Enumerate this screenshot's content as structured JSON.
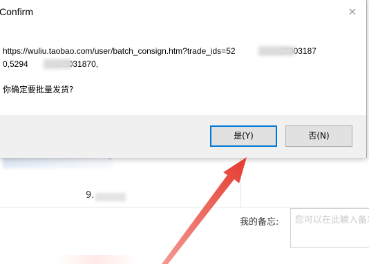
{
  "dialog": {
    "title": "Confirm",
    "close_glyph": "×",
    "message_line1": "https://wuliu.taobao.com/user/batch_consign.htm?trade_ids=52",
    "message_line1_tail": "17003187",
    "message_line2_head": "0,5294",
    "message_line2_tail": "240031870,",
    "question": "你确定要批量发货?",
    "yes_label": "是(Y)",
    "no_label": "否(N)",
    "accent_color": "#0078d7"
  },
  "background": {
    "number_prefix": "9.",
    "remark_label": "我的备忘:",
    "remark_placeholder": "您可以在此输入备忘"
  },
  "annotation": {
    "arrow_color": "#e8463a"
  }
}
